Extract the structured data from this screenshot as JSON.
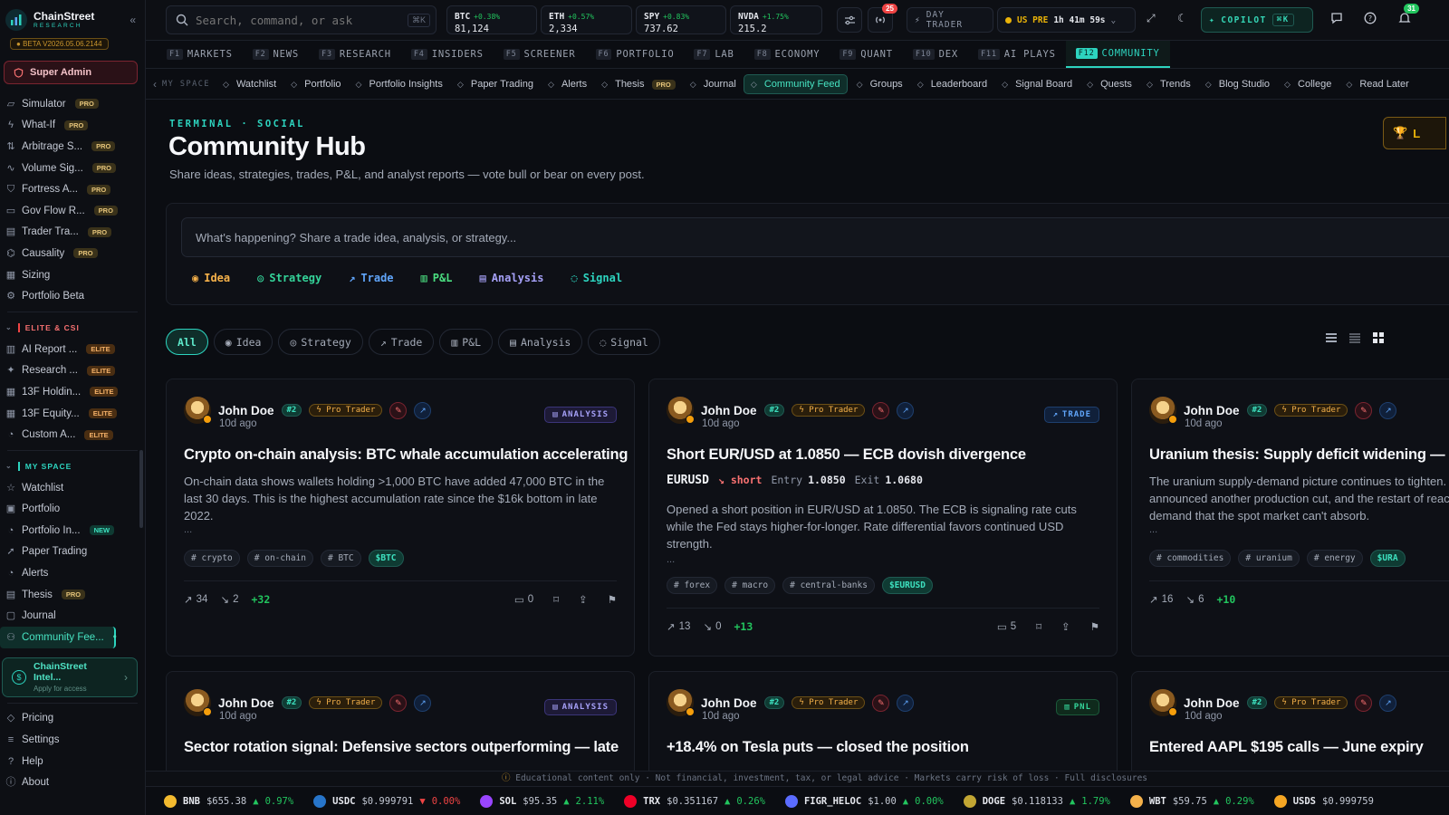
{
  "brand": {
    "name": "ChainStreet",
    "sub": "RESEARCH",
    "beta": "BETA V2026.05.06.2144"
  },
  "sidebar": {
    "super_admin": "Super Admin",
    "tools": [
      {
        "label": "Simulator",
        "badge": "PRO",
        "icon": "simulator-icon"
      },
      {
        "label": "What-If",
        "badge": "PRO",
        "icon": "lightning-icon"
      },
      {
        "label": "Arbitrage S...",
        "badge": "PRO",
        "icon": "arrows-icon"
      },
      {
        "label": "Volume Sig...",
        "badge": "PRO",
        "icon": "pulse-icon"
      },
      {
        "label": "Fortress A...",
        "badge": "PRO",
        "icon": "shield-icon"
      },
      {
        "label": "Gov Flow R...",
        "badge": "PRO",
        "icon": "card-icon"
      },
      {
        "label": "Trader Tra...",
        "badge": "PRO",
        "icon": "document-icon"
      },
      {
        "label": "Causality",
        "badge": "PRO",
        "icon": "network-icon"
      },
      {
        "label": "Sizing",
        "badge": "",
        "icon": "grid-icon"
      },
      {
        "label": "Portfolio Beta",
        "badge": "",
        "icon": "gear-icon"
      }
    ],
    "elite_heading": "ELITE & CSI",
    "elite": [
      {
        "label": "AI Report ...",
        "badge": "ELITE",
        "icon": "chart-icon"
      },
      {
        "label": "Research ...",
        "badge": "ELITE",
        "icon": "sparkle-icon"
      },
      {
        "label": "13F Holdin...",
        "badge": "ELITE",
        "icon": "building-icon"
      },
      {
        "label": "13F Equity...",
        "badge": "ELITE",
        "icon": "table-icon"
      },
      {
        "label": "Custom A...",
        "badge": "ELITE",
        "icon": "bell-icon"
      }
    ],
    "myspace_heading": "MY SPACE",
    "myspace": [
      {
        "label": "Watchlist",
        "badge": "",
        "icon": "star-icon"
      },
      {
        "label": "Portfolio",
        "badge": "",
        "icon": "briefcase-icon"
      },
      {
        "label": "Portfolio In...",
        "badge": "NEW",
        "icon": "pie-icon"
      },
      {
        "label": "Paper Trading",
        "badge": "",
        "icon": "send-icon"
      },
      {
        "label": "Alerts",
        "badge": "",
        "icon": "bell-icon"
      },
      {
        "label": "Thesis",
        "badge": "PRO",
        "icon": "document-icon"
      },
      {
        "label": "Journal",
        "badge": "",
        "icon": "book-icon"
      },
      {
        "label": "Community Fee...",
        "badge": "",
        "icon": "users-icon"
      }
    ],
    "intel": {
      "title": "ChainStreet Intel...",
      "sub": "Apply for access"
    },
    "footer": [
      {
        "label": "Pricing",
        "icon": "tag-icon"
      },
      {
        "label": "Settings",
        "icon": "sliders-icon"
      },
      {
        "label": "Help",
        "icon": "help-icon"
      },
      {
        "label": "About",
        "icon": "info-icon"
      }
    ]
  },
  "topbar": {
    "search_placeholder": "Search, command, or ask",
    "search_kbd": "⌘K",
    "tickers": [
      {
        "sym": "BTC",
        "chg": "+0.38%",
        "px": "81,124"
      },
      {
        "sym": "ETH",
        "chg": "+0.57%",
        "px": "2,334"
      },
      {
        "sym": "SPY",
        "chg": "+0.83%",
        "px": "737.62"
      },
      {
        "sym": "NVDA",
        "chg": "+1.75%",
        "px": "215.2"
      }
    ],
    "notif_count": "25",
    "mode": "DAY TRADER",
    "session": "US PRE",
    "countdown": "1h 41m 59s",
    "copilot": "COPILOT",
    "copilot_kbd": "⌘K",
    "bell_count": "31"
  },
  "fkeys": [
    {
      "k": "F1",
      "label": "MARKETS"
    },
    {
      "k": "F2",
      "label": "NEWS"
    },
    {
      "k": "F3",
      "label": "RESEARCH"
    },
    {
      "k": "F4",
      "label": "INSIDERS"
    },
    {
      "k": "F5",
      "label": "SCREENER"
    },
    {
      "k": "F6",
      "label": "PORTFOLIO"
    },
    {
      "k": "F7",
      "label": "LAB"
    },
    {
      "k": "F8",
      "label": "ECONOMY"
    },
    {
      "k": "F9",
      "label": "QUANT"
    },
    {
      "k": "F10",
      "label": "DEX"
    },
    {
      "k": "F11",
      "label": "AI PLAYS"
    },
    {
      "k": "F12",
      "label": "COMMUNITY"
    }
  ],
  "subnav": {
    "lead": "MY SPACE",
    "items": [
      {
        "label": "Watchlist",
        "badge": ""
      },
      {
        "label": "Portfolio",
        "badge": ""
      },
      {
        "label": "Portfolio Insights",
        "badge": ""
      },
      {
        "label": "Paper Trading",
        "badge": ""
      },
      {
        "label": "Alerts",
        "badge": ""
      },
      {
        "label": "Thesis",
        "badge": "PRO"
      },
      {
        "label": "Journal",
        "badge": ""
      },
      {
        "label": "Community Feed",
        "badge": ""
      },
      {
        "label": "Groups",
        "badge": ""
      },
      {
        "label": "Leaderboard",
        "badge": ""
      },
      {
        "label": "Signal Board",
        "badge": ""
      },
      {
        "label": "Quests",
        "badge": ""
      },
      {
        "label": "Trends",
        "badge": ""
      },
      {
        "label": "Blog Studio",
        "badge": ""
      },
      {
        "label": "College",
        "badge": ""
      },
      {
        "label": "Read Later",
        "badge": ""
      }
    ]
  },
  "page": {
    "kicker": "TERMINAL · SOCIAL",
    "title": "Community Hub",
    "subtitle": "Share ideas, strategies, trades, P&L, and analyst reports — vote bull or bear on every post.",
    "hof_label": "L",
    "composer_placeholder": "What's happening? Share a trade idea, analysis, or strategy...",
    "composer_types": [
      {
        "label": "Idea",
        "color": "#f5b14a"
      },
      {
        "label": "Strategy",
        "color": "#34d399"
      },
      {
        "label": "Trade",
        "color": "#60a5fa"
      },
      {
        "label": "P&L",
        "color": "#4ade80"
      },
      {
        "label": "Analysis",
        "color": "#a5a0f7"
      },
      {
        "label": "Signal",
        "color": "#2dd4bf"
      }
    ],
    "filters": [
      "All",
      "Idea",
      "Strategy",
      "Trade",
      "P&L",
      "Analysis",
      "Signal"
    ]
  },
  "posts": [
    {
      "author": "John Doe",
      "rank": "#2",
      "role": "Pro Trader",
      "time": "10d ago",
      "type": "ANALYSIS",
      "title": "Crypto on-chain analysis: BTC whale accumulation accelerating",
      "body": "On-chain data shows wallets holding >1,000 BTC have added 47,000 BTC in the last 30 days. This is the highest accumulation rate since the $16k bottom in late 2022.",
      "tags": [
        "crypto",
        "on-chain",
        "BTC"
      ],
      "cashtag": "$BTC",
      "bull": "34",
      "bear": "2",
      "net": "+32",
      "comments": "0"
    },
    {
      "author": "John Doe",
      "rank": "#2",
      "role": "Pro Trader",
      "time": "10d ago",
      "type": "TRADE",
      "title": "Short EUR/USD at 1.0850 — ECB dovish divergence",
      "trade": {
        "pair": "EURUSD",
        "dir": "short",
        "entry_label": "Entry",
        "entry": "1.0850",
        "exit_label": "Exit",
        "exit": "1.0680"
      },
      "body": "Opened a short position in EUR/USD at 1.0850. The ECB is signaling rate cuts while the Fed stays higher-for-longer. Rate differential favors continued USD strength.",
      "tags": [
        "forex",
        "macro",
        "central-banks"
      ],
      "cashtag": "$EURUSD",
      "bull": "13",
      "bear": "0",
      "net": "+13",
      "comments": "5"
    },
    {
      "author": "John Doe",
      "rank": "#2",
      "role": "Pro Trader",
      "time": "10d ago",
      "type": "",
      "title": "Uranium thesis: Supply deficit widening —",
      "body": "The uranium supply-demand picture continues to tighten. Kazatomprom just announced another production cut, and the restart of reactors is adding incremental demand that the spot market can't absorb.",
      "tags": [
        "commodities",
        "uranium",
        "energy"
      ],
      "cashtag": "$URA",
      "bull": "16",
      "bear": "6",
      "net": "+10",
      "comments": ""
    },
    {
      "author": "John Doe",
      "rank": "#2",
      "role": "Pro Trader",
      "time": "10d ago",
      "type": "ANALYSIS",
      "title": "Sector rotation signal: Defensive sectors outperforming — late"
    },
    {
      "author": "John Doe",
      "rank": "#2",
      "role": "Pro Trader",
      "time": "10d ago",
      "type": "PNL",
      "title": "+18.4% on Tesla puts — closed the position"
    },
    {
      "author": "John Doe",
      "rank": "#2",
      "role": "Pro Trader",
      "time": "10d ago",
      "type": "",
      "title": "Entered AAPL $195 calls — June expiry"
    }
  ],
  "disclaimer": "Educational content only · Not financial, investment, tax, or legal advice · Markets carry risk of loss · Full disclosures",
  "tape": [
    {
      "sym": "BNB",
      "px": "$655.38",
      "chg": "0.97%",
      "dir": "up",
      "color": "#f3ba2f"
    },
    {
      "sym": "USDC",
      "px": "$0.999791",
      "chg": "0.00%",
      "dir": "down",
      "color": "#2775ca"
    },
    {
      "sym": "SOL",
      "px": "$95.35",
      "chg": "2.11%",
      "dir": "up",
      "color": "#9945ff"
    },
    {
      "sym": "TRX",
      "px": "$0.351167",
      "chg": "0.26%",
      "dir": "up",
      "color": "#ef0027"
    },
    {
      "sym": "FIGR_HELOC",
      "px": "$1.00",
      "chg": "0.00%",
      "dir": "up",
      "color": "#5b6cff"
    },
    {
      "sym": "DOGE",
      "px": "$0.118133",
      "chg": "1.79%",
      "dir": "up",
      "color": "#c2a633"
    },
    {
      "sym": "WBT",
      "px": "$59.75",
      "chg": "0.29%",
      "dir": "up",
      "color": "#f5b14a"
    },
    {
      "sym": "USDS",
      "px": "$0.999759",
      "chg": "",
      "dir": "up",
      "color": "#f5a623"
    }
  ]
}
